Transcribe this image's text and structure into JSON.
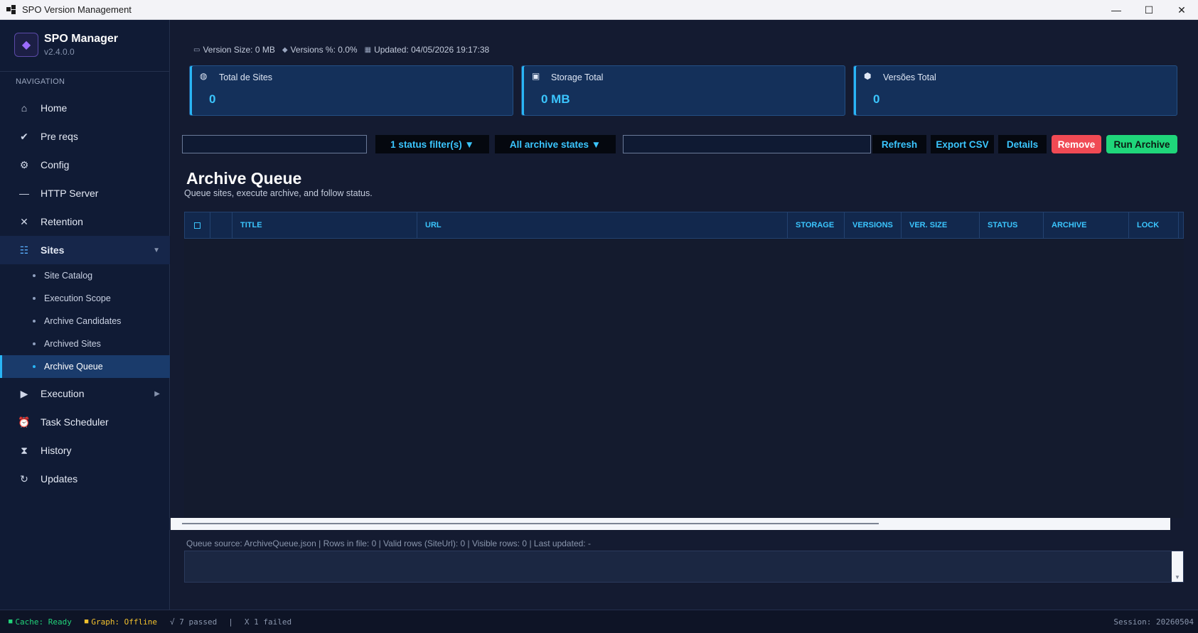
{
  "window": {
    "title": "SPO Version Management",
    "minimize": "—",
    "maximize": "☐",
    "close": "✕"
  },
  "brand": {
    "name": "SPO Manager",
    "version": "v2.4.0.0",
    "logo": "◆"
  },
  "nav": {
    "heading": "NAVIGATION",
    "items": [
      {
        "label": "Home",
        "icon": "home-icon"
      },
      {
        "label": "Pre reqs",
        "icon": "check-icon"
      },
      {
        "label": "Config",
        "icon": "gear-icon"
      },
      {
        "label": "HTTP Server",
        "icon": "minus-icon"
      },
      {
        "label": "Retention",
        "icon": "close-icon"
      },
      {
        "label": "Sites",
        "icon": "list-icon"
      },
      {
        "label": "Execution",
        "icon": "play-icon"
      },
      {
        "label": "Task Scheduler",
        "icon": "alarm-icon"
      },
      {
        "label": "History",
        "icon": "hourglass-icon"
      },
      {
        "label": "Updates",
        "icon": "refresh-icon"
      }
    ],
    "sites_sub": [
      "Site Catalog",
      "Execution Scope",
      "Archive Candidates",
      "Archived Sites",
      "Archive Queue"
    ]
  },
  "infobar": {
    "version_size": "Version Size: 0 MB",
    "versions_pct": "Versions %: 0.0%",
    "updated": "Updated: 04/05/2026 19:17:38"
  },
  "cards": [
    {
      "label": "Total de Sites",
      "value": "0",
      "icon": "globe-icon"
    },
    {
      "label": "Storage Total",
      "value": "0 MB",
      "icon": "disk-icon"
    },
    {
      "label": "Versões Total",
      "value": "0",
      "icon": "cube-icon"
    }
  ],
  "toolbar": {
    "search_value": "",
    "status_filter": "1 status filter(s) ▼",
    "archive_filter": "All archive states ▼",
    "second_input_value": "",
    "refresh": "Refresh",
    "export": "Export CSV",
    "details": "Details",
    "remove": "Remove",
    "run": "Run Archive"
  },
  "page": {
    "title": "Archive Queue",
    "subtitle": "Queue sites, execute archive, and follow status."
  },
  "table": {
    "columns": [
      "TITLE",
      "URL",
      "STORAGE",
      "VERSIONS",
      "VER. SIZE",
      "STATUS",
      "ARCHIVE",
      "LOCK"
    ],
    "rows": []
  },
  "queue_source": "Queue source: ArchiveQueue.json | Rows in file: 0 | Valid rows (SiteUrl): 0 | Visible rows: 0 | Last updated: -",
  "status": {
    "cache": "Cache: Ready",
    "graph": "Graph: Offline",
    "passed": "√ 7 passed",
    "sep": "|",
    "failed": "X 1 failed",
    "session": "Session: 20260504"
  },
  "colors": {
    "accent": "#3bc6ff",
    "remove": "#f04a54",
    "run": "#1fd67a",
    "cache_ok": "#22d37a",
    "graph_offline": "#f2c12e"
  }
}
